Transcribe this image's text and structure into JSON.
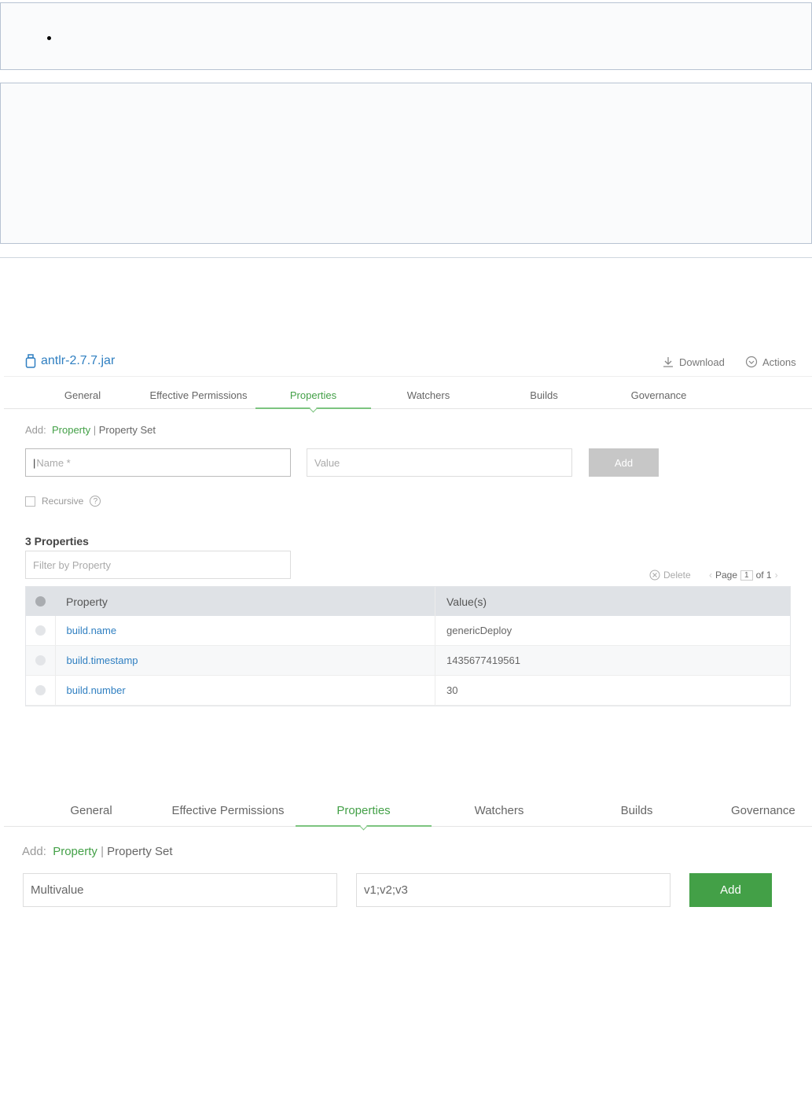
{
  "file": {
    "name": "antlr-2.7.7.jar"
  },
  "actions": {
    "download": "Download",
    "actions": "Actions"
  },
  "tabs": [
    "General",
    "Effective Permissions",
    "Properties",
    "Watchers",
    "Builds",
    "Governance"
  ],
  "panel1": {
    "add_label": "Add:",
    "add_property": "Property",
    "separator": "|",
    "add_property_set": "Property Set",
    "name_placeholder": "Name *",
    "value_placeholder": "Value",
    "add_button": "Add",
    "recursive_label": "Recursive",
    "help_glyph": "?",
    "count_label": "3 Properties",
    "filter_placeholder": "Filter by Property",
    "delete_label": "Delete",
    "pager": {
      "page_label": "Page",
      "page": "1",
      "of_label": "of 1"
    },
    "table": {
      "headers": [
        "Property",
        "Value(s)"
      ],
      "rows": [
        {
          "property": "build.name",
          "value": "genericDeploy"
        },
        {
          "property": "build.timestamp",
          "value": "1435677419561"
        },
        {
          "property": "build.number",
          "value": "30"
        }
      ]
    }
  },
  "panel2": {
    "add_label": "Add:",
    "add_property": "Property",
    "separator": "|",
    "add_property_set": "Property Set",
    "name_value": "Multivalue",
    "value_value": "v1;v2;v3",
    "add_button": "Add"
  },
  "colors": {
    "accent_green": "#43a047",
    "link_blue": "#2f7fc1"
  }
}
